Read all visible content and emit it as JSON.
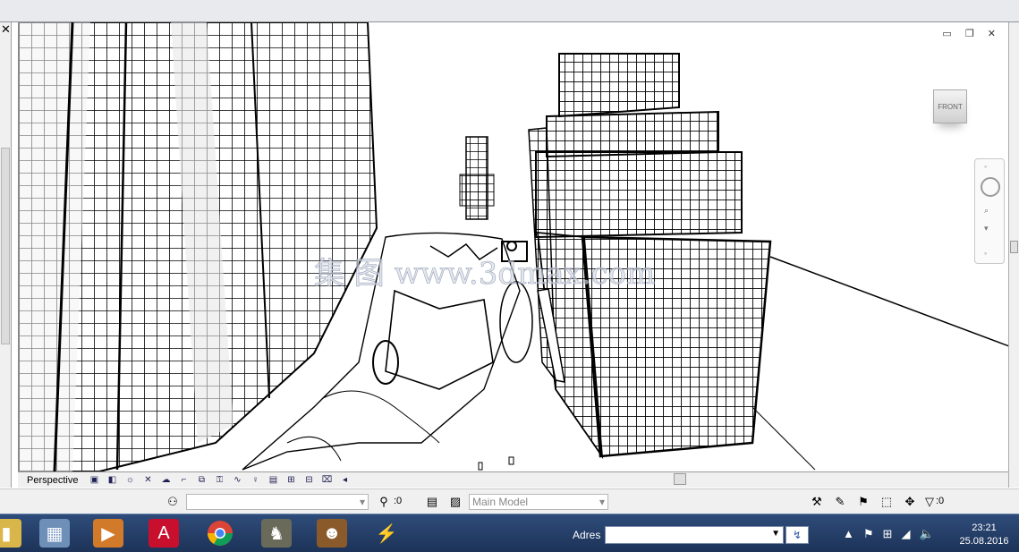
{
  "window": {
    "close_glyph": "✕",
    "view_controls": "▭ ❐ ✕"
  },
  "viewcube": {
    "label": "FRONT"
  },
  "navbar": {
    "icons": [
      "steering-wheel-icon",
      "zoom-icon",
      "pan-icon"
    ]
  },
  "view_status": {
    "mode": "Perspective",
    "icons": [
      "view-cube-icon",
      "visual-style-icon",
      "sun-path-icon",
      "shadows-icon",
      "render-icon",
      "crop-icon",
      "show-crop-icon",
      "lock-view-icon",
      "temporary-hide-icon",
      "reveal-hidden-icon",
      "analytical-model-icon",
      "highlight-displacement-icon",
      "worksharing-icon",
      "design-options-icon"
    ]
  },
  "status_bar": {
    "selection_count": ":0",
    "workset": "Main Model",
    "filter_count": ":0"
  },
  "watermark": "集 图 www.3dmax.com",
  "taskbar": {
    "apps": [
      "explorer",
      "calculator",
      "media-player",
      "autocad",
      "chrome",
      "game-assassin",
      "game-mafia",
      "winamp"
    ],
    "address_label": "Adres",
    "address_value": "",
    "clock_time": "23:21",
    "clock_date": "25.08.2016"
  },
  "colors": {
    "taskbar": "#1d3358",
    "chrome_bg": "#f0f0f0",
    "autocad_red": "#c8102e"
  }
}
